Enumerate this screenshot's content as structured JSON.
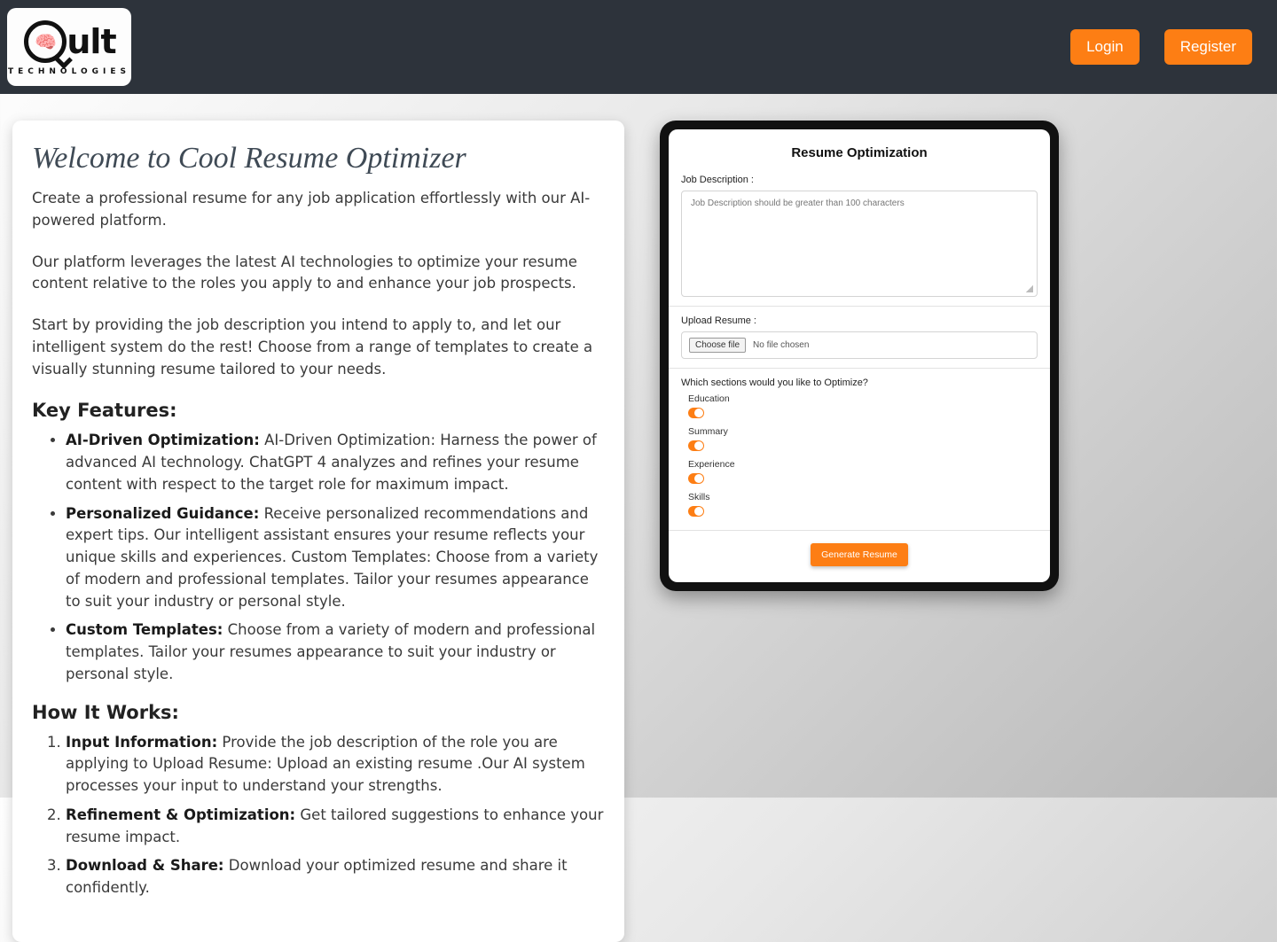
{
  "header": {
    "brand_main": "ult",
    "brand_sub": "TECHNOLOGIES",
    "login_label": "Login",
    "register_label": "Register"
  },
  "left": {
    "title": "Welcome to Cool Resume Optimizer",
    "para1": "Create a professional resume for any job application effortlessly with our AI-powered platform.",
    "para2": "Our platform leverages the latest AI technologies to optimize your resume content relative to the roles you apply to and enhance your job prospects.",
    "para3": "Start by providing the job description you intend to apply to, and let our intelligent system do the rest! Choose from a range of templates to create a visually stunning resume tailored to your needs.",
    "features_heading": "Key Features:",
    "features": [
      {
        "label": "AI-Driven Optimization:",
        "text": " AI-Driven Optimization: Harness the power of advanced AI technology. ChatGPT 4 analyzes and refines your resume content with respect to the target role for maximum impact."
      },
      {
        "label": "Personalized Guidance:",
        "text": " Receive personalized recommendations and expert tips. Our intelligent assistant ensures your resume reflects your unique skills and experiences. Custom Templates: Choose from a variety of modern and professional templates. Tailor your resumes appearance to suit your industry or personal style."
      },
      {
        "label": "Custom Templates:",
        "text": " Choose from a variety of modern and professional templates. Tailor your resumes appearance to suit your industry or personal style."
      }
    ],
    "how_heading": "How It Works:",
    "how": [
      {
        "label": "Input Information:",
        "text": " Provide the job description of the role you are applying to Upload Resume: Upload an existing resume .Our AI system processes your input to understand your strengths."
      },
      {
        "label": "Refinement & Optimization:",
        "text": " Get tailored suggestions to enhance your resume impact."
      },
      {
        "label": "Download & Share:",
        "text": " Download your optimized resume and share it confidently."
      }
    ]
  },
  "form": {
    "title": "Resume Optimization",
    "jd_label": "Job Description :",
    "jd_placeholder": "Job Description should be greater than 100 characters",
    "upload_label": "Upload Resume :",
    "choose_file": "Choose file",
    "no_file": "No file chosen",
    "optimize_question": "Which sections would you like to Optimize?",
    "sections": [
      "Education",
      "Summary",
      "Experience",
      "Skills"
    ],
    "generate_label": "Generate Resume"
  }
}
